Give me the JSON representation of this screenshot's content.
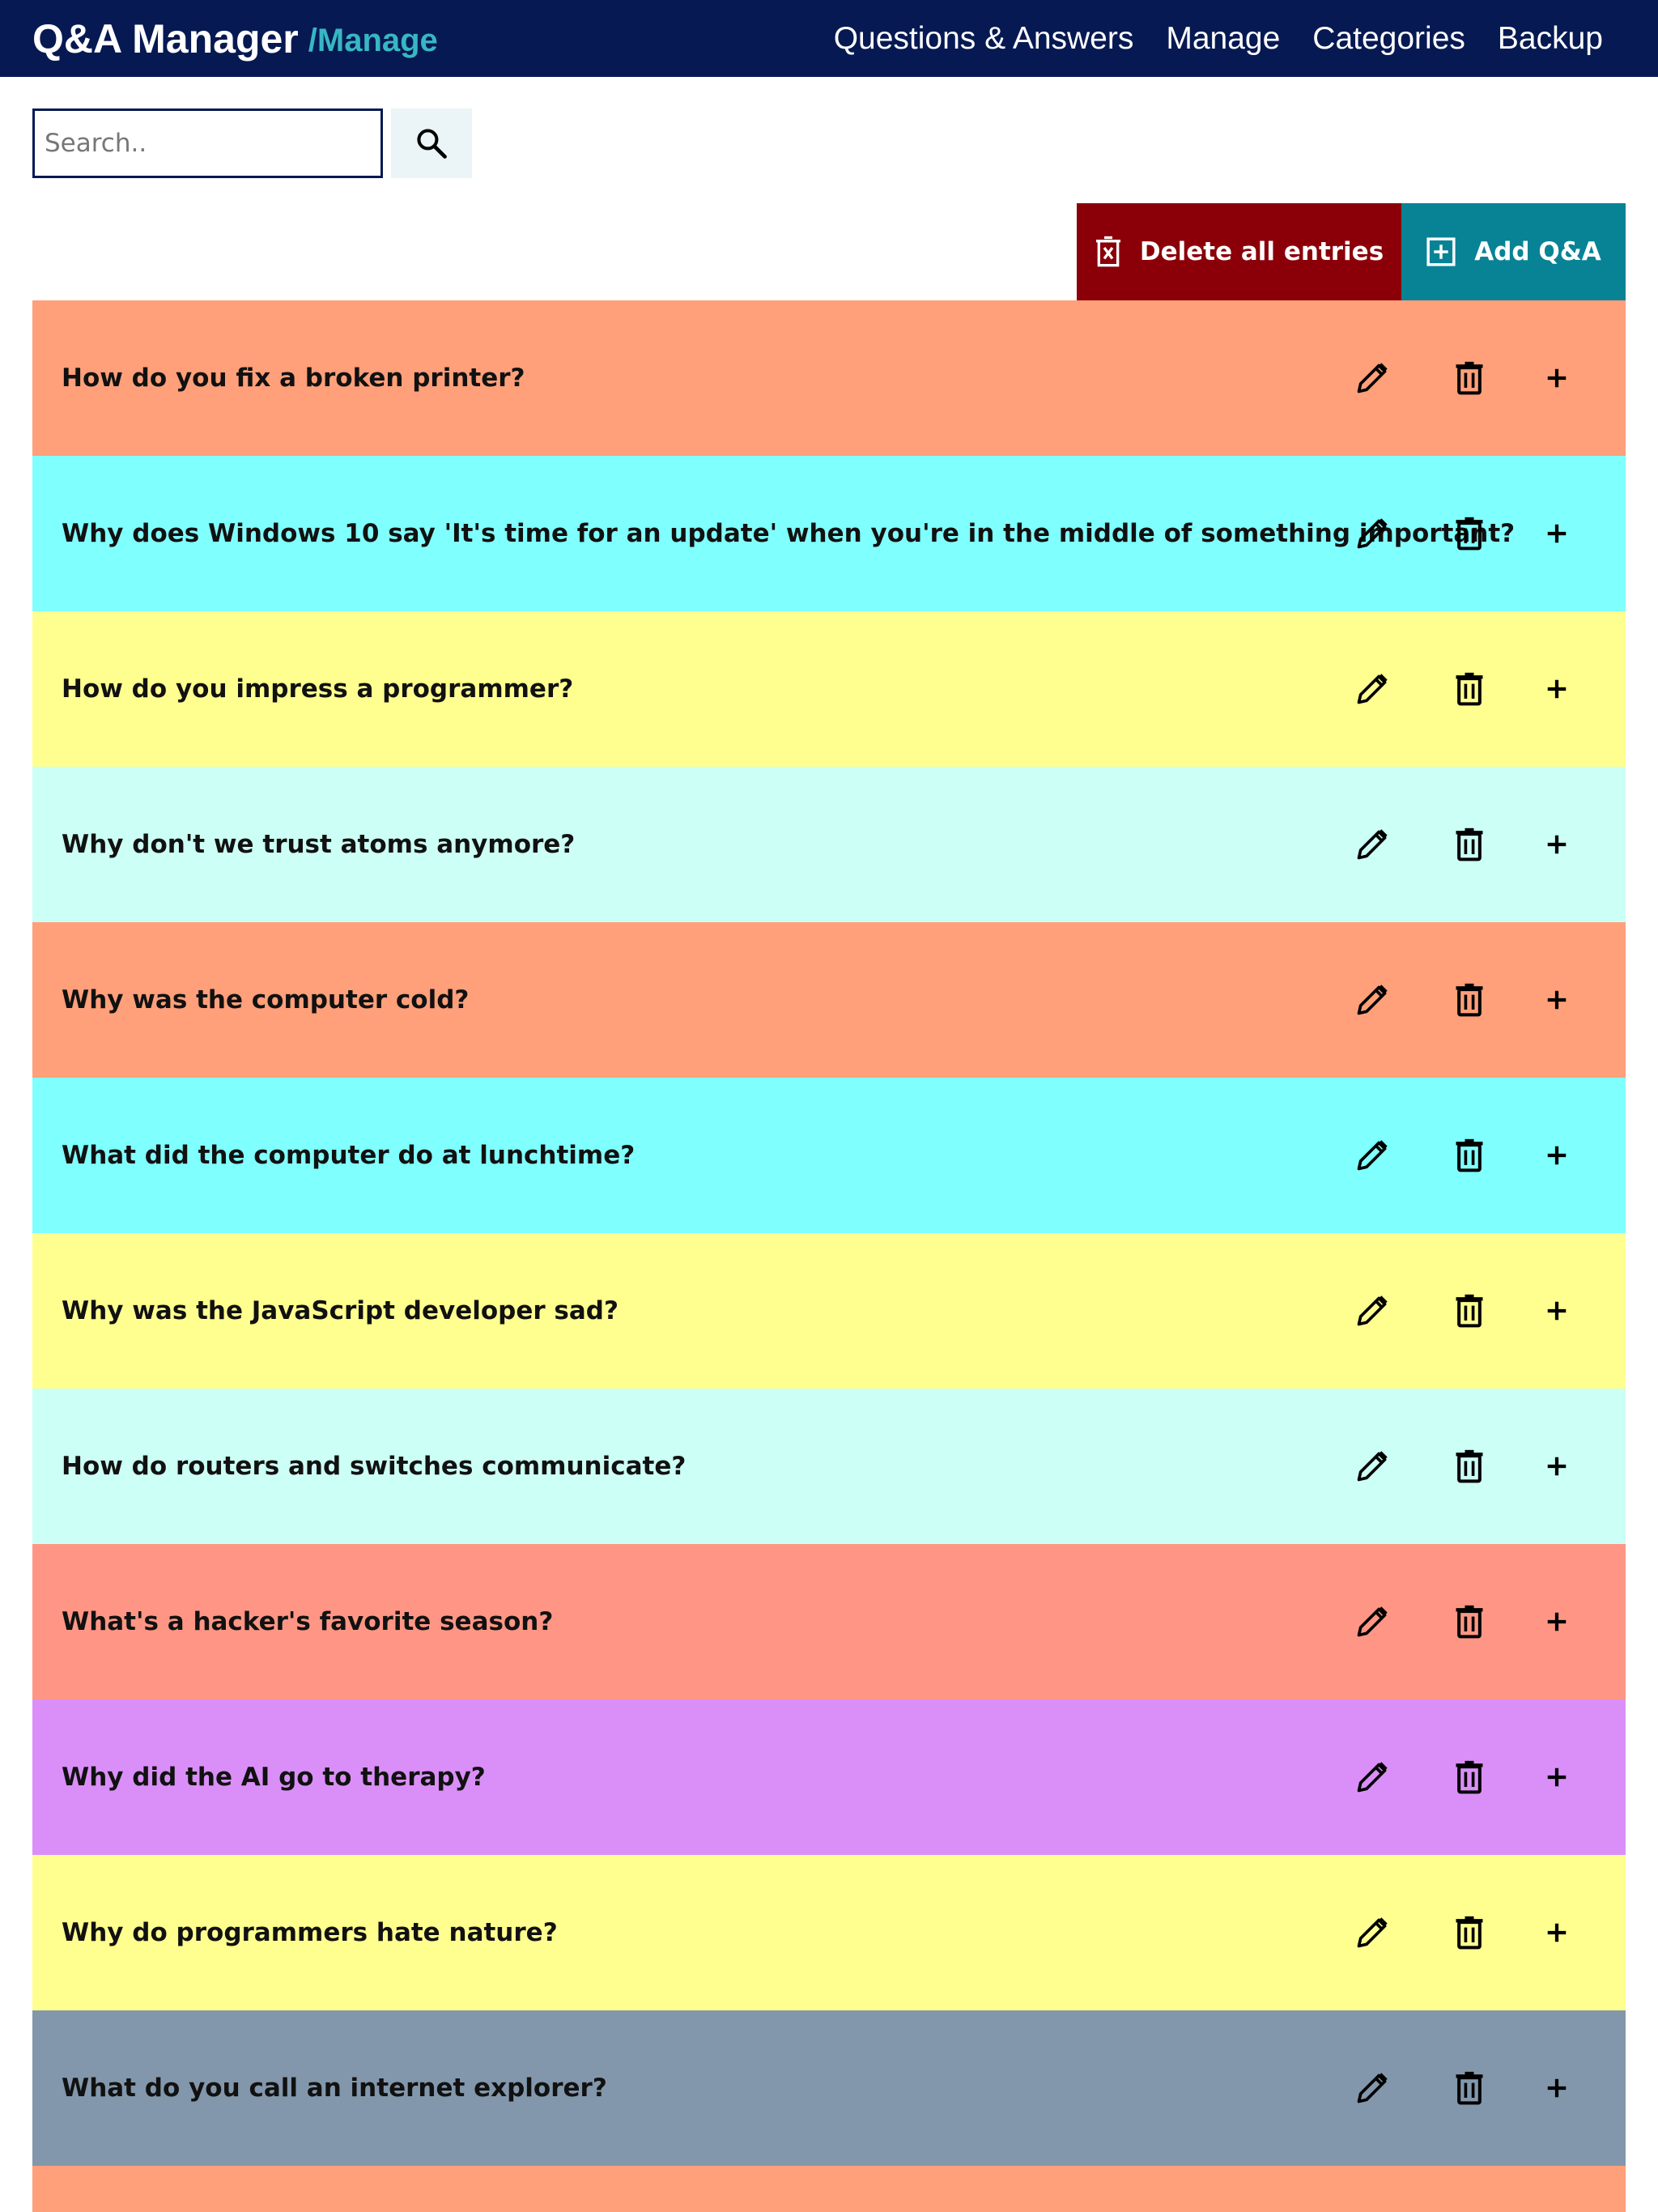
{
  "header": {
    "title": "Q&A Manager",
    "subtitle": "/Manage",
    "nav": [
      {
        "label": "Questions & Answers"
      },
      {
        "label": "Manage"
      },
      {
        "label": "Categories"
      },
      {
        "label": "Backup"
      }
    ]
  },
  "search": {
    "placeholder": "Search..",
    "value": "",
    "icon": "search-icon"
  },
  "actions": {
    "delete_all_label": "Delete all entries",
    "delete_all_icon": "delete-all-icon",
    "add_label": "Add Q&A",
    "add_icon": "add-box-icon"
  },
  "row_icons": [
    "pencil-icon",
    "trash-icon",
    "plus-icon"
  ],
  "qa_items": [
    {
      "question": "How do you fix a broken printer?",
      "color": "#ffa07a"
    },
    {
      "question": "Why does Windows 10 say 'It's time for an update' when you're in the middle of something important?",
      "color": "#80ffff"
    },
    {
      "question": "How do you impress a programmer?",
      "color": "#ffff8f"
    },
    {
      "question": "Why don't we trust atoms anymore?",
      "color": "#ccfff5"
    },
    {
      "question": "Why was the computer cold?",
      "color": "#ffa07a"
    },
    {
      "question": "What did the computer do at lunchtime?",
      "color": "#80ffff"
    },
    {
      "question": "Why was the JavaScript developer sad?",
      "color": "#ffff8f"
    },
    {
      "question": "How do routers and switches communicate?",
      "color": "#ccfff5"
    },
    {
      "question": "What's a hacker's favorite season?",
      "color": "#ff9685"
    },
    {
      "question": "Why did the AI go to therapy?",
      "color": "#da8ff8"
    },
    {
      "question": "Why do programmers hate nature?",
      "color": "#ffff8f"
    },
    {
      "question": "What do you call an internet explorer?",
      "color": "#8297ab"
    },
    {
      "question": "",
      "color": "#ffa07a"
    }
  ],
  "colors": {
    "header_bg": "#071952",
    "accent": "#37b7c3",
    "delete_bg": "#8b0008",
    "add_bg": "#088395",
    "search_button_bg": "#ebf4f6"
  }
}
